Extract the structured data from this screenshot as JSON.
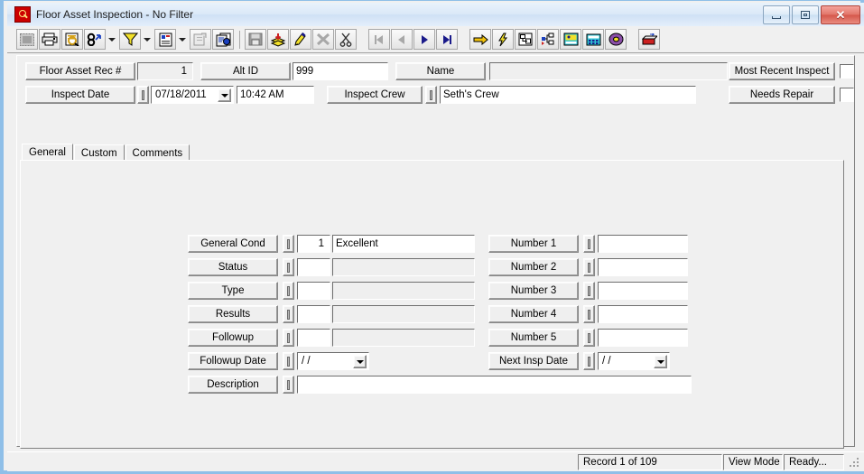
{
  "window": {
    "title": "Floor Asset Inspection - No Filter",
    "icon": "magnifier-red-icon",
    "minimize_label": "",
    "restore_label": "",
    "close_label": "✕"
  },
  "toolbar": {
    "items": [
      {
        "name": "select-all-icon",
        "tip": "Select All",
        "enabled": false
      },
      {
        "name": "print-icon",
        "tip": "Print",
        "enabled": true
      },
      {
        "name": "print-preview-icon",
        "tip": "Print Preview",
        "enabled": true
      },
      {
        "name": "find-icon",
        "tip": "Find",
        "enabled": true
      },
      {
        "name": "find-dropdown-arrow",
        "tip": "Find Options",
        "enabled": true
      },
      {
        "name": "filter-icon",
        "tip": "Filter",
        "enabled": true
      },
      {
        "name": "filter-dropdown-arrow",
        "tip": "Filter Options",
        "enabled": true
      },
      {
        "name": "report-icon",
        "tip": "Report",
        "enabled": true
      },
      {
        "name": "report-dropdown-arrow",
        "tip": "Report Options",
        "enabled": true
      },
      {
        "name": "export-icon",
        "tip": "Export",
        "enabled": false
      },
      {
        "name": "copy-record-icon",
        "tip": "Copy Record",
        "enabled": true
      },
      {
        "name": "save-icon",
        "tip": "Save",
        "enabled": false
      },
      {
        "name": "add-record-icon",
        "tip": "Add Record",
        "enabled": true
      },
      {
        "name": "edit-record-icon",
        "tip": "Edit Record",
        "enabled": true
      },
      {
        "name": "delete-record-icon",
        "tip": "Delete Record",
        "enabled": false
      },
      {
        "name": "cut-icon",
        "tip": "Cut",
        "enabled": true
      },
      {
        "name": "first-record-icon",
        "tip": "First Record",
        "enabled": false
      },
      {
        "name": "previous-record-icon",
        "tip": "Previous Record",
        "enabled": false
      },
      {
        "name": "next-record-icon",
        "tip": "Next Record",
        "enabled": true
      },
      {
        "name": "last-record-icon",
        "tip": "Last Record",
        "enabled": true
      },
      {
        "name": "goto-icon",
        "tip": "Go To",
        "enabled": true
      },
      {
        "name": "quick-action-icon",
        "tip": "Quick Action",
        "enabled": true
      },
      {
        "name": "layout-icon",
        "tip": "Layout",
        "enabled": true
      },
      {
        "name": "tree-view-icon",
        "tip": "Tree View",
        "enabled": true
      },
      {
        "name": "image-icon",
        "tip": "Image",
        "enabled": true
      },
      {
        "name": "calculator-icon",
        "tip": "Calculator",
        "enabled": true
      },
      {
        "name": "help-icon",
        "tip": "Help",
        "enabled": true
      },
      {
        "name": "exit-icon",
        "tip": "Exit",
        "enabled": true
      }
    ]
  },
  "header": {
    "rec_label": "Floor Asset Rec #",
    "rec_value": "1",
    "alt_id_label": "Alt ID",
    "alt_id_value": "999",
    "name_label": "Name",
    "name_value": "",
    "most_recent_label": "Most Recent Inspect",
    "most_recent_checked": false,
    "inspect_date_label": "Inspect Date",
    "inspect_date_value": "07/18/2011",
    "inspect_time_value": "10:42 AM",
    "inspect_crew_label": "Inspect Crew",
    "inspect_crew_value": "Seth's Crew",
    "needs_repair_label": "Needs Repair",
    "needs_repair_checked": false
  },
  "tabs": [
    {
      "label": "General",
      "active": true
    },
    {
      "label": "Custom",
      "active": false
    },
    {
      "label": "Comments",
      "active": false
    }
  ],
  "form": {
    "left": [
      {
        "label": "General Cond",
        "code": "1",
        "value": "Excellent",
        "type": "code-text",
        "readonly_value": false
      },
      {
        "label": "Status",
        "code": "",
        "value": "",
        "type": "code-text",
        "readonly_value": true
      },
      {
        "label": "Type",
        "code": "",
        "value": "",
        "type": "code-text",
        "readonly_value": true
      },
      {
        "label": "Results",
        "code": "",
        "value": "",
        "type": "code-text",
        "readonly_value": true
      },
      {
        "label": "Followup",
        "code": "",
        "value": "",
        "type": "code-text",
        "readonly_value": true
      },
      {
        "label": "Followup Date",
        "code": "",
        "value": "  /  /",
        "type": "date"
      }
    ],
    "description": {
      "label": "Description",
      "value": ""
    },
    "right": [
      {
        "label": "Number 1",
        "value": "",
        "type": "text"
      },
      {
        "label": "Number 2",
        "value": "",
        "type": "text"
      },
      {
        "label": "Number 3",
        "value": "",
        "type": "text"
      },
      {
        "label": "Number 4",
        "value": "",
        "type": "text"
      },
      {
        "label": "Number 5",
        "value": "",
        "type": "text"
      },
      {
        "label": "Next Insp Date",
        "value": "  /  /",
        "type": "date"
      }
    ]
  },
  "statusbar": {
    "record": "Record 1 of 109",
    "mode": "View Mode",
    "state": "Ready..."
  },
  "colors": {
    "title_accent": "#cc0000",
    "window_border": "#8fbfe8",
    "face": "#f0f0f0",
    "field_bg": "#ffffff",
    "readonly_bg": "#efefef",
    "close_button": "#d4564a"
  }
}
